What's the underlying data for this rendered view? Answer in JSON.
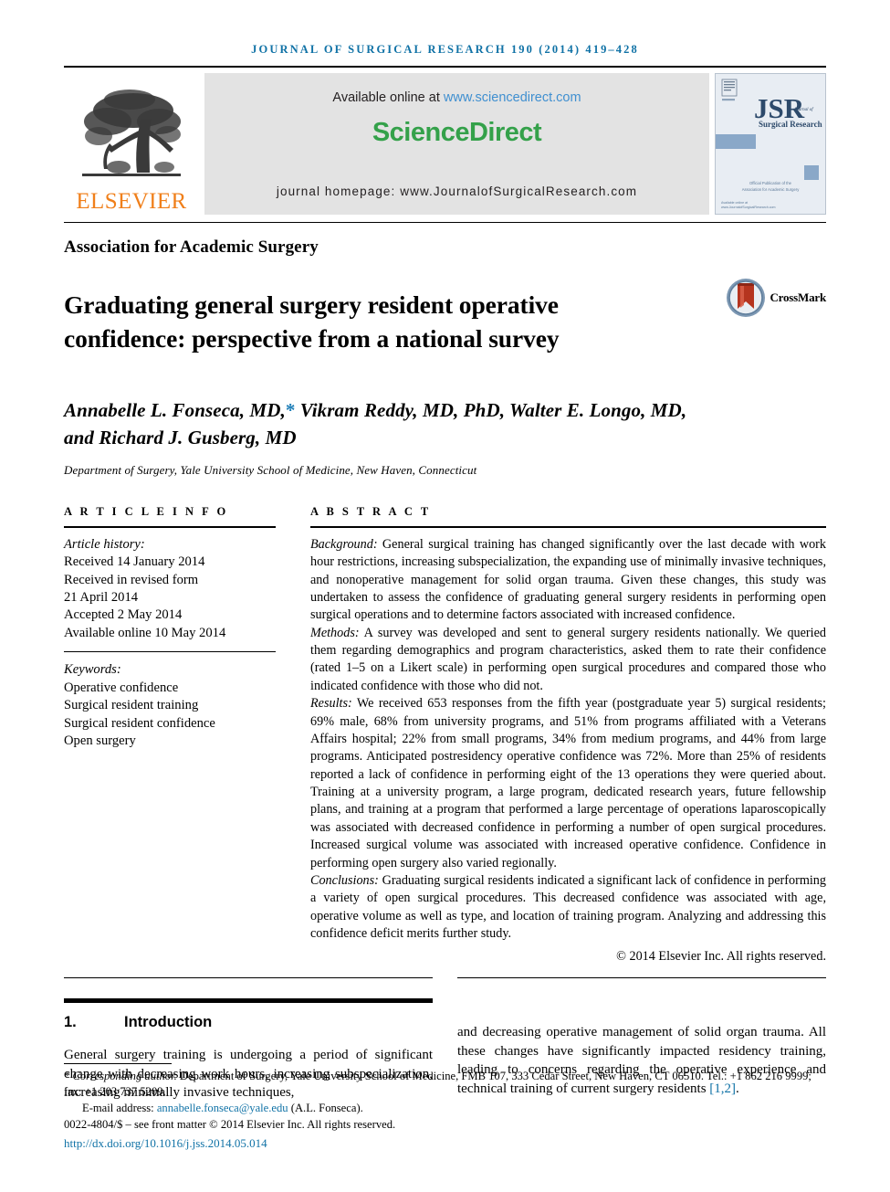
{
  "running_head": "JOURNAL OF SURGICAL RESEARCH 190 (2014) 419–428",
  "masthead": {
    "publisher_name": "ELSEVIER",
    "available_prefix": "Available online at ",
    "available_url": "www.sciencedirect.com",
    "sciencedirect_logo": "ScienceDirect",
    "homepage_line": "journal homepage: www.JournalofSurgicalResearch.com",
    "cover": {
      "acronym": "JSR",
      "journal_word": "Journal of",
      "journal_name": "Surgical Research",
      "footer_line_1": "Official Publication of the",
      "footer_line_2": "Association for Academic Surgery",
      "corner_line_1": "Available online at",
      "corner_line_2": "www.JournalofSurgicalResearch.com",
      "bg_color": "#e8edf3",
      "accent_color": "#7a9ec4"
    }
  },
  "society": "Association for Academic Surgery",
  "title": "Graduating general surgery resident operative confidence: perspective from a national survey",
  "crossmark": {
    "label": "CrossMark",
    "ring_color": "#6f8fae",
    "ribbon_color": "#c0392b"
  },
  "authors": {
    "line1_a": "Annabelle L. Fonseca, MD,",
    "star": "*",
    "line1_b": " Vikram Reddy, MD, PhD, Walter E. Longo, MD,",
    "line2": "and Richard J. Gusberg, MD"
  },
  "affiliation": "Department of Surgery, Yale University School of Medicine, New Haven, Connecticut",
  "article_info": {
    "heading": "A R T I C L E   I N F O",
    "history_label": "Article history:",
    "history": [
      "Received 14 January 2014",
      "Received in revised form",
      "21 April 2014",
      "Accepted 2 May 2014",
      "Available online 10 May 2014"
    ],
    "keywords_label": "Keywords:",
    "keywords": [
      "Operative confidence",
      "Surgical resident training",
      "Surgical resident confidence",
      "Open surgery"
    ]
  },
  "abstract": {
    "heading": "A B S T R A C T",
    "background_label": "Background:",
    "background_text": " General surgical training has changed significantly over the last decade with work hour restrictions, increasing subspecialization, the expanding use of minimally invasive techniques, and nonoperative management for solid organ trauma. Given these changes, this study was undertaken to assess the confidence of graduating general surgery residents in performing open surgical operations and to determine factors associated with increased confidence.",
    "methods_label": "Methods:",
    "methods_text": " A survey was developed and sent to general surgery residents nationally. We queried them regarding demographics and program characteristics, asked them to rate their confidence (rated 1–5 on a Likert scale) in performing open surgical procedures and compared those who indicated confidence with those who did not.",
    "results_label": "Results:",
    "results_text": " We received 653 responses from the fifth year (postgraduate year 5) surgical residents; 69% male, 68% from university programs, and 51% from programs affiliated with a Veterans Affairs hospital; 22% from small programs, 34% from medium programs, and 44% from large programs. Anticipated postresidency operative confidence was 72%. More than 25% of residents reported a lack of confidence in performing eight of the 13 operations they were queried about. Training at a university program, a large program, dedicated research years, future fellowship plans, and training at a program that performed a large percentage of operations laparoscopically was associated with decreased confidence in performing a number of open surgical procedures. Increased surgical volume was associated with increased operative confidence. Confidence in performing open surgery also varied regionally.",
    "conclusions_label": "Conclusions:",
    "conclusions_text": " Graduating surgical residents indicated a significant lack of confidence in performing a variety of open surgical procedures. This decreased confidence was associated with age, operative volume as well as type, and location of training program. Analyzing and addressing this confidence deficit merits further study.",
    "copyright": "© 2014 Elsevier Inc. All rights reserved."
  },
  "body": {
    "section_number": "1.",
    "section_title": "Introduction",
    "left_paragraph": "General surgery training is undergoing a period of significant change with decreasing work hours, increasing subspecialization, increasing minimally invasive techniques,",
    "right_paragraph_a": "and decreasing operative management of solid organ trauma. All these changes have significantly impacted residency training, leading to concerns regarding the operative experience and technical training of current surgery residents ",
    "right_reference": "[1,2]",
    "right_paragraph_b": "."
  },
  "footnotes": {
    "corresponding_label": "* Corresponding author.",
    "corresponding_text": " Department of Surgery, Yale University School of Medicine, FMB 107, 333 Cedar Street, New Haven, CT 06510. Tel.: +1 862 216 9999; fax: +1 203 737 5209.",
    "email_label": "E-mail address: ",
    "email_address": "annabelle.fonseca@yale.edu",
    "email_suffix": " (A.L. Fonseca).",
    "issn_line": "0022-4804/$ – see front matter © 2014 Elsevier Inc. All rights reserved.",
    "doi": "http://dx.doi.org/10.1016/j.jss.2014.05.014"
  }
}
